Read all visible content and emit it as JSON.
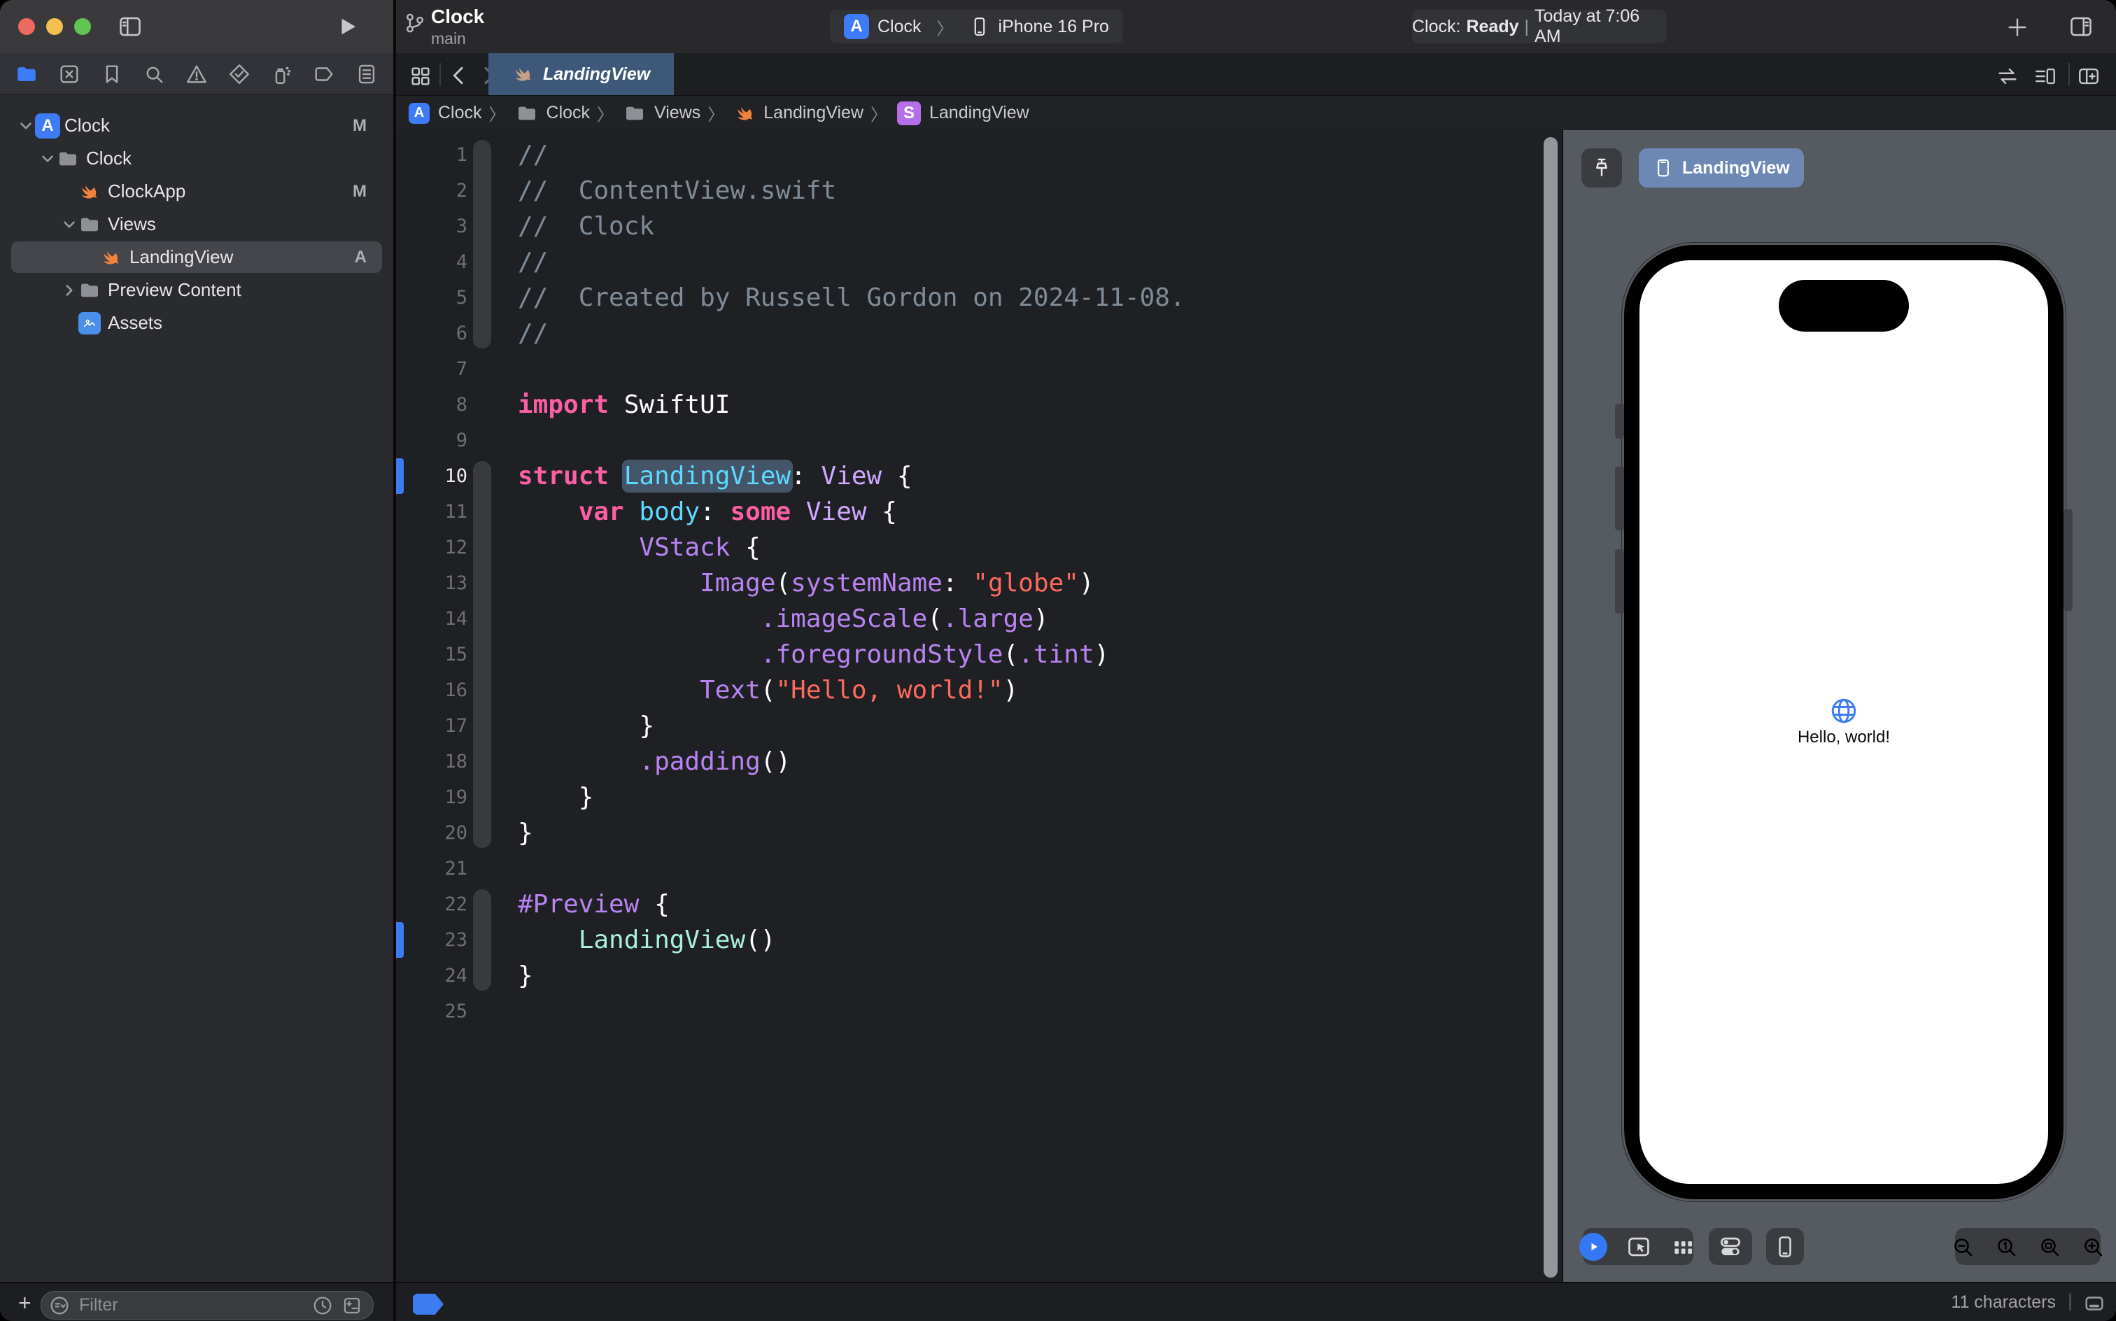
{
  "window_controls": {
    "close": "#EC6A5E",
    "minimize": "#F4BF4F",
    "zoom_btn": "#61C554"
  },
  "toolbar": {
    "project_title": "Clock",
    "branch": "main",
    "scheme": {
      "app": "Clock",
      "separator": "〉",
      "device": "iPhone 16 Pro"
    },
    "status": {
      "app": "Clock:",
      "state": "Ready",
      "separator": "|",
      "time": "Today at 7:06 AM"
    }
  },
  "navigator": {
    "tabs": [
      {
        "name": "project-navigator",
        "icon": "folder",
        "active": true
      },
      {
        "name": "source-control-navigator",
        "icon": "square-x",
        "active": false
      },
      {
        "name": "bookmark-navigator",
        "icon": "bookmark",
        "active": false
      },
      {
        "name": "find-navigator",
        "icon": "search",
        "active": false
      },
      {
        "name": "issue-navigator",
        "icon": "warning",
        "active": false
      },
      {
        "name": "test-navigator",
        "icon": "diamond-check",
        "active": false
      },
      {
        "name": "debug-navigator",
        "icon": "spray",
        "active": false
      },
      {
        "name": "breakpoint-navigator",
        "icon": "tag",
        "active": false
      },
      {
        "name": "report-navigator",
        "icon": "doc-list",
        "active": false
      }
    ],
    "tree": [
      {
        "label": "Clock",
        "icon": "app",
        "badge": "M",
        "level": 0,
        "chevron": "down"
      },
      {
        "label": "Clock",
        "icon": "folder",
        "badge": "",
        "level": 1,
        "chevron": "down"
      },
      {
        "label": "ClockApp",
        "icon": "swift",
        "badge": "M",
        "level": 2,
        "chevron": ""
      },
      {
        "label": "Views",
        "icon": "folder",
        "badge": "",
        "level": 2,
        "chevron": "down"
      },
      {
        "label": "LandingView",
        "icon": "swift",
        "badge": "A",
        "level": 3,
        "chevron": "",
        "selected": true
      },
      {
        "label": "Preview Content",
        "icon": "folder",
        "badge": "",
        "level": 2,
        "chevron": "right"
      },
      {
        "label": "Assets",
        "icon": "assets",
        "badge": "",
        "level": 2,
        "chevron": ""
      }
    ],
    "footer": {
      "add_label": "+",
      "filter_placeholder": "Filter"
    }
  },
  "tabbar": {
    "active_tab": "LandingView"
  },
  "jumpbar": {
    "items": [
      {
        "icon": "app"
      },
      {
        "label": "Clock"
      },
      {
        "icon": "folder"
      },
      {
        "label": "Clock"
      },
      {
        "icon": "folder"
      },
      {
        "label": "Views"
      },
      {
        "icon": "swift"
      },
      {
        "label": "LandingView"
      },
      {
        "icon": "sbadge"
      },
      {
        "label": "LandingView"
      }
    ],
    "separator": "〉"
  },
  "editor": {
    "ribbons": [
      {
        "from": 1,
        "to": 6
      },
      {
        "from": 10,
        "to": 20
      },
      {
        "from": 22,
        "to": 24
      }
    ],
    "lines": [
      {
        "n": 1,
        "tokens": [
          [
            "com",
            "//"
          ]
        ]
      },
      {
        "n": 2,
        "tokens": [
          [
            "com",
            "//  ContentView.swift"
          ]
        ]
      },
      {
        "n": 3,
        "tokens": [
          [
            "com",
            "//  Clock"
          ]
        ]
      },
      {
        "n": 4,
        "tokens": [
          [
            "com",
            "//"
          ]
        ]
      },
      {
        "n": 5,
        "tokens": [
          [
            "com",
            "//  Created by Russell Gordon on 2024-11-08."
          ]
        ]
      },
      {
        "n": 6,
        "tokens": [
          [
            "com",
            "//"
          ]
        ]
      },
      {
        "n": 7,
        "tokens": []
      },
      {
        "n": 8,
        "tokens": [
          [
            "kw",
            "import"
          ],
          [
            "pl",
            " SwiftUI"
          ]
        ]
      },
      {
        "n": 9,
        "tokens": []
      },
      {
        "n": 10,
        "change": true,
        "numBright": true,
        "tokens": [
          [
            "kw",
            "struct"
          ],
          [
            "pl",
            " "
          ],
          [
            "decl",
            "LandingView",
            "sel"
          ],
          [
            "pl",
            ": "
          ],
          [
            "type",
            "View"
          ],
          [
            "pl",
            " {"
          ]
        ]
      },
      {
        "n": 11,
        "tokens": [
          [
            "pl",
            "    "
          ],
          [
            "kw",
            "var"
          ],
          [
            "pl",
            " "
          ],
          [
            "decl",
            "body"
          ],
          [
            "pl",
            ": "
          ],
          [
            "kw",
            "some"
          ],
          [
            "pl",
            " "
          ],
          [
            "type",
            "View"
          ],
          [
            "pl",
            " {"
          ]
        ]
      },
      {
        "n": 12,
        "tokens": [
          [
            "pl",
            "        "
          ],
          [
            "sdk",
            "VStack"
          ],
          [
            "pl",
            " {"
          ]
        ]
      },
      {
        "n": 13,
        "tokens": [
          [
            "pl",
            "            "
          ],
          [
            "sdk",
            "Image"
          ],
          [
            "pl",
            "("
          ],
          [
            "sdk",
            "systemName"
          ],
          [
            "pl",
            ": "
          ],
          [
            "str",
            "\"globe\""
          ],
          [
            "pl",
            ")"
          ]
        ]
      },
      {
        "n": 14,
        "tokens": [
          [
            "pl",
            "                "
          ],
          [
            "sdk",
            ".imageScale"
          ],
          [
            "pl",
            "("
          ],
          [
            "sdk",
            ".large"
          ],
          [
            "pl",
            ")"
          ]
        ]
      },
      {
        "n": 15,
        "tokens": [
          [
            "pl",
            "                "
          ],
          [
            "sdk",
            ".foregroundStyle"
          ],
          [
            "pl",
            "("
          ],
          [
            "sdk",
            ".tint"
          ],
          [
            "pl",
            ")"
          ]
        ]
      },
      {
        "n": 16,
        "tokens": [
          [
            "pl",
            "            "
          ],
          [
            "sdk",
            "Text"
          ],
          [
            "pl",
            "("
          ],
          [
            "str",
            "\"Hello, world!\""
          ],
          [
            "pl",
            ")"
          ]
        ]
      },
      {
        "n": 17,
        "tokens": [
          [
            "pl",
            "        }"
          ]
        ]
      },
      {
        "n": 18,
        "tokens": [
          [
            "pl",
            "        "
          ],
          [
            "sdk",
            ".padding"
          ],
          [
            "pl",
            "()"
          ]
        ]
      },
      {
        "n": 19,
        "tokens": [
          [
            "pl",
            "    }"
          ]
        ]
      },
      {
        "n": 20,
        "tokens": [
          [
            "pl",
            "}"
          ]
        ]
      },
      {
        "n": 21,
        "tokens": []
      },
      {
        "n": 22,
        "tokens": [
          [
            "sdk",
            "#Preview"
          ],
          [
            "pl",
            " {"
          ]
        ]
      },
      {
        "n": 23,
        "change": true,
        "tokens": [
          [
            "pl",
            "    "
          ],
          [
            "proj",
            "LandingView"
          ],
          [
            "pl",
            "()"
          ]
        ]
      },
      {
        "n": 24,
        "tokens": [
          [
            "pl",
            "}"
          ]
        ]
      },
      {
        "n": 25,
        "tokens": []
      }
    ]
  },
  "preview": {
    "chip_label": "LandingView",
    "canvas_text": "Hello, world!",
    "accent_blue": "#3B7CF7",
    "statusbar_text": "11 characters",
    "statusbar_separator": "|"
  },
  "colors": {
    "tab_active": "#3D5878",
    "chip": "#6E88B5",
    "change_bar": "#3C7BF0",
    "folder_blue": "#3E7BF6"
  }
}
